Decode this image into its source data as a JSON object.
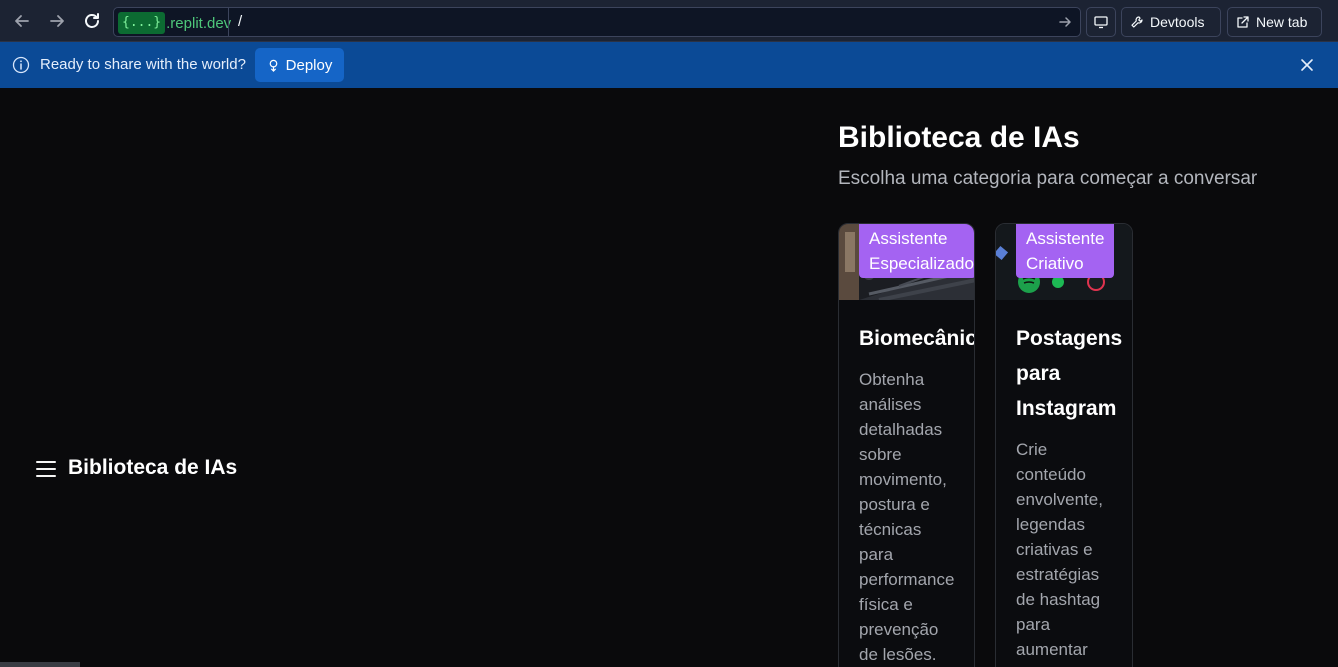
{
  "browser": {
    "url_badge": "{...}",
    "url_domain": ".replit.dev",
    "url_path": "/",
    "devtools_label": "Devtools",
    "newtab_label": "New tab"
  },
  "banner": {
    "message": "Ready to share with the world?",
    "deploy_label": "Deploy"
  },
  "app": {
    "brand": "Biblioteca de IAs",
    "heading": "Biblioteca de IAs",
    "subheading": "Escolha uma categoria para começar a conversar",
    "cards": [
      {
        "badge_line1": "Assistente",
        "badge_line2": "Especializado",
        "title": "Biomecânica",
        "desc": "Obtenha análises detalhadas sobre movimento, postura e técnicas para performance física e prevenção de lesões."
      },
      {
        "badge_line1": "Assistente",
        "badge_line2": "Criativo",
        "title": "Postagens para Instagram",
        "desc": "Crie conteúdo envolvente, legendas criativas e estratégias de hashtag para aumentar"
      }
    ]
  },
  "colors": {
    "browser_bar": "#1c2333",
    "banner": "#0b4a96",
    "deploy_button": "#1565c7",
    "badge": "#a463f2",
    "page_bg": "#0a0a0c"
  }
}
